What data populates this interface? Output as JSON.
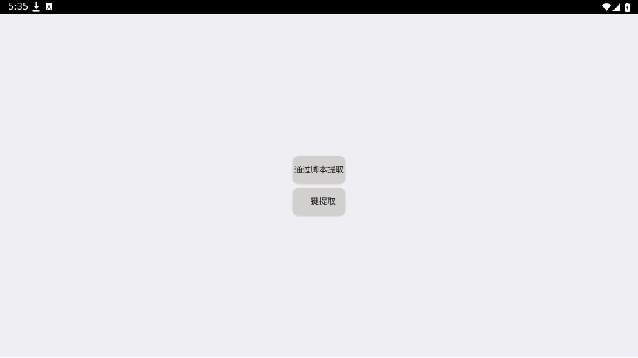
{
  "status_bar": {
    "time": "5:35",
    "left_icons": [
      "download-icon",
      "notification-a-icon"
    ],
    "right_icons": [
      "wifi-icon",
      "cellular-signal-icon",
      "battery-icon"
    ]
  },
  "main": {
    "buttons": [
      {
        "label": "通过脚本提取"
      },
      {
        "label": "一键提取"
      }
    ]
  },
  "colors": {
    "background": "#efeef3",
    "status_bar": "#000000",
    "button_bg": "#d2d0cf",
    "button_text": "#1a1a1a"
  }
}
